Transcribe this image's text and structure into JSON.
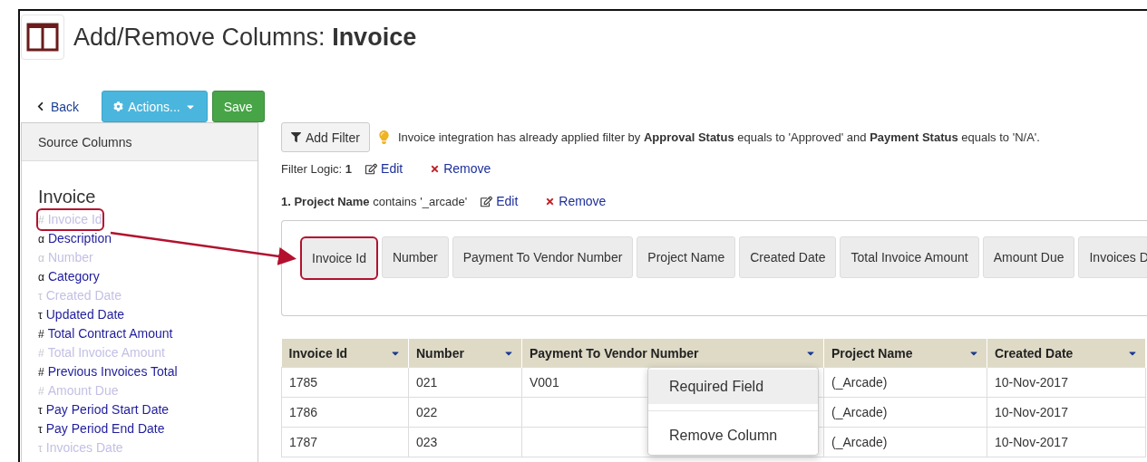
{
  "window": {
    "title": "Add/Remove Columns: **Invoice**"
  },
  "toolbar": {
    "back": "Back",
    "actions": "Actions...",
    "save": "Save"
  },
  "source_panel": {
    "header": "Source Columns",
    "group": "Invoice",
    "items": [
      {
        "type_mark": "#",
        "label": "Invoice Id",
        "disabled": true,
        "highlighted": true
      },
      {
        "type_mark": "α",
        "label": "Description",
        "disabled": false,
        "highlighted": false
      },
      {
        "type_mark": "α",
        "label": "Number",
        "disabled": true,
        "highlighted": false
      },
      {
        "type_mark": "α",
        "label": "Category",
        "disabled": false,
        "highlighted": false
      },
      {
        "type_mark": "τ",
        "label": "Created Date",
        "disabled": true,
        "highlighted": false
      },
      {
        "type_mark": "τ",
        "label": "Updated Date",
        "disabled": false,
        "highlighted": false
      },
      {
        "type_mark": "#",
        "label": "Total Contract Amount",
        "disabled": false,
        "highlighted": false
      },
      {
        "type_mark": "#",
        "label": "Total Invoice Amount",
        "disabled": true,
        "highlighted": false
      },
      {
        "type_mark": "#",
        "label": "Previous Invoices Total",
        "disabled": false,
        "highlighted": false
      },
      {
        "type_mark": "#",
        "label": "Amount Due",
        "disabled": true,
        "highlighted": false
      },
      {
        "type_mark": "τ",
        "label": "Pay Period Start Date",
        "disabled": false,
        "highlighted": false
      },
      {
        "type_mark": "τ",
        "label": "Pay Period End Date",
        "disabled": false,
        "highlighted": false
      },
      {
        "type_mark": "τ",
        "label": "Invoices Date",
        "disabled": true,
        "highlighted": false
      }
    ]
  },
  "filter": {
    "add_button": "Add Filter",
    "notice": "Invoice integration has already applied filter by **Approval Status** equals to 'Approved' and **Payment Status** equals to 'N/A'.",
    "logic_label": "Filter Logic: **1**",
    "edit": "Edit",
    "remove": "Remove",
    "conditions": [
      {
        "text": "**1. Project Name** contains '_arcade'",
        "edit": "Edit",
        "remove": "Remove"
      }
    ]
  },
  "selected_columns": [
    {
      "label": "Invoice Id",
      "highlighted": true
    },
    {
      "label": "Number",
      "highlighted": false
    },
    {
      "label": "Payment To Vendor Number",
      "highlighted": false
    },
    {
      "label": "Project Name",
      "highlighted": false
    },
    {
      "label": "Created Date",
      "highlighted": false
    },
    {
      "label": "Total Invoice Amount",
      "highlighted": false
    },
    {
      "label": "Amount Due",
      "highlighted": false
    },
    {
      "label": "Invoices D",
      "highlighted": false
    }
  ],
  "table": {
    "columns": [
      "Invoice Id",
      "Number",
      "Payment To Vendor Number",
      "Project Name",
      "Created Date"
    ],
    "rows": [
      [
        "1785",
        "021",
        "V001",
        "(_Arcade)",
        "10-Nov-2017"
      ],
      [
        "1786",
        "022",
        "",
        "(_Arcade)",
        "10-Nov-2017"
      ],
      [
        "1787",
        "023",
        "",
        "(_Arcade)",
        "10-Nov-2017"
      ]
    ]
  },
  "context_menu": {
    "items": [
      {
        "label": "Required Field",
        "highlighted": true
      },
      {
        "label": "Remove Column",
        "highlighted": false
      }
    ]
  }
}
